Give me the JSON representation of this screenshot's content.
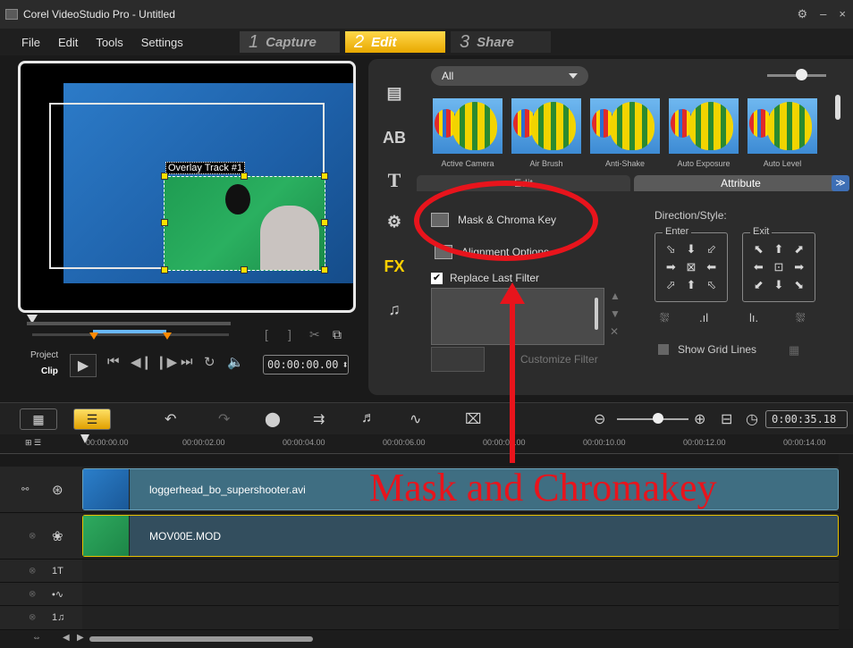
{
  "window": {
    "title": "Corel VideoStudio Pro - Untitled",
    "controls": [
      "⚙",
      "–",
      "×"
    ]
  },
  "menu": [
    "File",
    "Edit",
    "Tools",
    "Settings"
  ],
  "steps": [
    {
      "num": "1",
      "label": "Capture"
    },
    {
      "num": "2",
      "label": "Edit"
    },
    {
      "num": "3",
      "label": "Share"
    }
  ],
  "preview": {
    "overlay_label": "Overlay Track #1",
    "project_label": "Project",
    "clip_label": "Clip",
    "timecode": "00:00:00.00"
  },
  "library": {
    "category": "All",
    "thumbnails": [
      "Active Camera",
      "Air Brush",
      "Anti-Shake",
      "Auto Exposure",
      "Auto Level"
    ],
    "tabs": [
      "Edit",
      "Attribute"
    ],
    "options": {
      "mask_chroma": "Mask & Chroma Key",
      "alignment": "Alignment Options",
      "replace_filter": "Replace Last Filter",
      "customize_filter": "Customize Filter"
    },
    "direction_title": "Direction/Style:",
    "enter_label": "Enter",
    "exit_label": "Exit",
    "show_grid": "Show Grid Lines"
  },
  "timeline": {
    "timecode": "0:00:35.18",
    "ruler": [
      "00:00:00.00",
      "00:00:02.00",
      "00:00:04.00",
      "00:00:06.00",
      "00:00:08.00",
      "00:00:10.00",
      "00:00:12.00",
      "00:00:14.00"
    ],
    "clips": {
      "video": "loggerhead_bo_supershooter.avi",
      "overlay": "MOV00E.MOD"
    }
  },
  "annotation": "Mask and Chromakey"
}
